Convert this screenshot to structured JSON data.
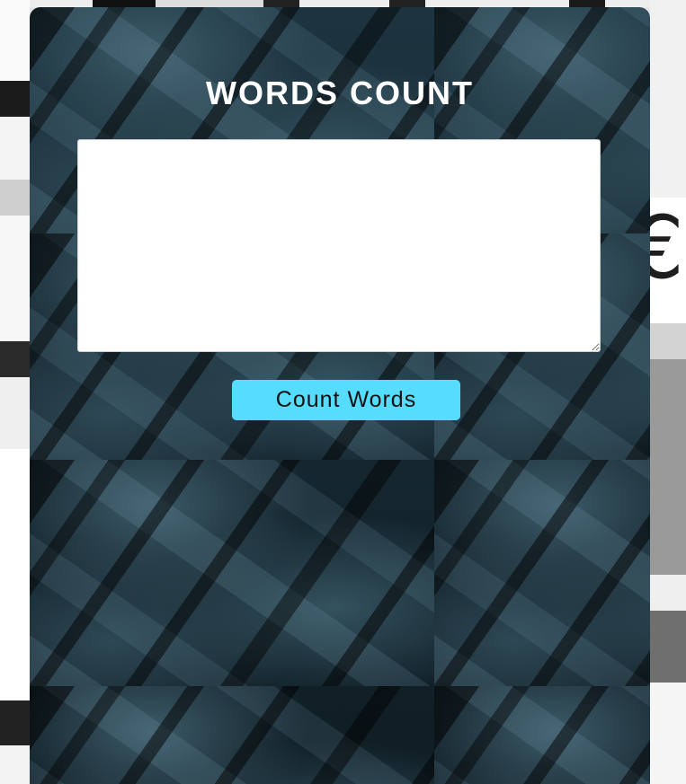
{
  "page": {
    "title": "WORDS COUNT"
  },
  "editor": {
    "value": "",
    "placeholder": ""
  },
  "actions": {
    "count_label": "Count Words"
  },
  "colors": {
    "button_bg": "#55dcff",
    "title_text": "#ffffff",
    "card_bg": "#14232b"
  }
}
